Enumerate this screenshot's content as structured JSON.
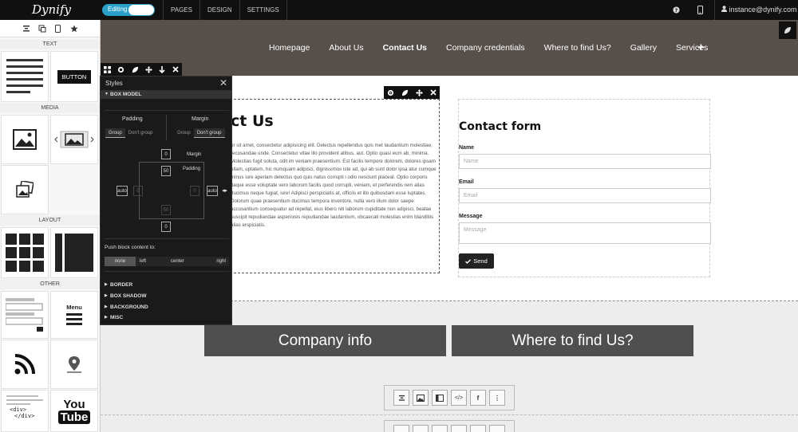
{
  "topbar": {
    "logo": "Dynify",
    "editing_label": "Editing",
    "nav": [
      "PAGES",
      "DESIGN",
      "SETTINGS"
    ],
    "user_email": "instance@dynify.com",
    "icons": [
      "help-icon",
      "mobile-icon",
      "user-icon"
    ]
  },
  "sidebar": {
    "tool_icons": [
      "align-icon",
      "copy-icon",
      "mobile-icon",
      "star-icon"
    ],
    "sections": {
      "text": "TEXT",
      "media": "MEDIA",
      "layout": "LAYOUT",
      "other": "OTHER"
    },
    "button_tile_label": "BUTTON",
    "menu_tile_label": "Menu",
    "div_tile_lines": [
      "<div>",
      "</div>"
    ],
    "youtube_tile": [
      "You",
      "Tube"
    ]
  },
  "site": {
    "nav": [
      "Homepage",
      "About Us",
      "Contact Us",
      "Company credentials",
      "Where to find Us?",
      "Gallery",
      "Services"
    ],
    "active_nav": "Contact Us",
    "heading": "ct Us",
    "body": "or sit amet, consectetur adipisicing elit. Delectus repellendus quis met laudantium molestiae, recusandae unde. Consectetur vitae illo provident atibus, aut. Optio quasi eum ab, minima. Molestias fugit soluta, odit im veniam praesentium. Est facilis tempore dolorem, dolores ipsam ullam, uptatem, hic numquam adipisci, dignissimos iste ad, qui ab sunt dolor ipsa atur cumque minus iure aperiam delectus quo quis natus corrupti i odio nesciunt placeat. Optio corporis itaque esse voluptate vero laborum facilis quod corrupti, veniam, et perferendis rem alias ducimus neque fugiat, iure! Adipisci perspiciatis at, officiis et illo quibusdam esse luptates. Dolorum quae praesentium ducimus tempora inventore, nulla vero illum dolor saepe accusantium consequatur ad repellat, eius libero niti laborum cupiditate non adipisci, beatae suscipit repudiandae asperiores repudiandae laudantium, obcaecati molestias enim blanditiis alias erspiciatis.",
    "contact_form": {
      "title": "Contact form",
      "name_label": "Name",
      "name_placeholder": "Name",
      "email_label": "Email",
      "email_placeholder": "Email",
      "message_label": "Message",
      "message_placeholder": "Message",
      "send_label": "Send"
    },
    "big_buttons": [
      "Company info",
      "Where to find Us?"
    ]
  },
  "styles_panel": {
    "title": "Styles",
    "sections": [
      "BOX MODEL",
      "BORDER",
      "BOX SHADOW",
      "BACKGROUND",
      "MISC"
    ],
    "padding_label": "Padding",
    "margin_label": "Margin",
    "group_label": "Group",
    "dont_group_label": "Don't group",
    "margin_box_label": "Margin",
    "padding_box_label": "Padding",
    "margin_top": "0",
    "padding_top": "50",
    "padding_left": "0",
    "padding_right": "0",
    "padding_bottom": "50",
    "margin_bottom": "0",
    "margin_left": "auto",
    "margin_right": "auto",
    "push_label": "Push block content to:",
    "push_options": [
      "none",
      "left",
      "center",
      "right"
    ],
    "push_selected": "none"
  }
}
